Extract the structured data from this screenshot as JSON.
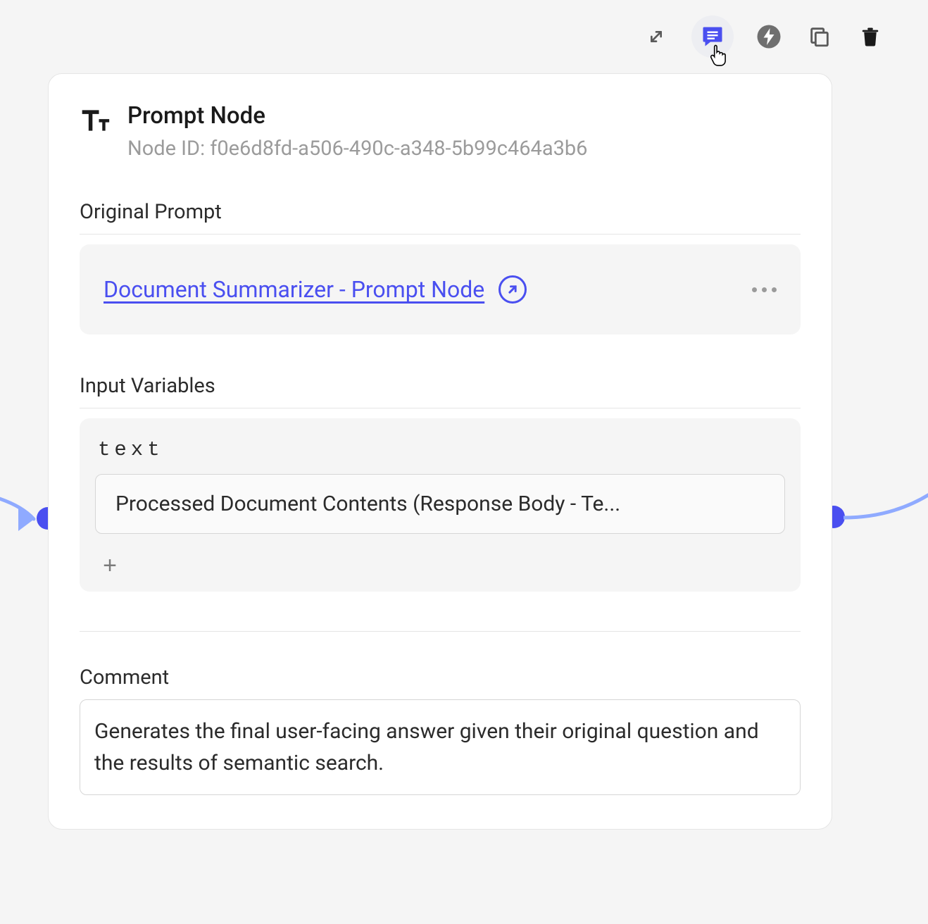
{
  "toolbar": {
    "expand": "expand",
    "comment": "comment",
    "flash": "flash",
    "copy": "copy",
    "delete": "delete"
  },
  "node": {
    "title": "Prompt Node",
    "id_label": "Node ID: ",
    "id_value": "f0e6d8fd-a506-490c-a348-5b99c464a3b6"
  },
  "sections": {
    "original_prompt": "Original Prompt",
    "input_variables": "Input Variables",
    "comment": "Comment"
  },
  "prompt": {
    "link_text": "Document Summarizer - Prompt Node"
  },
  "variables": [
    {
      "name": "text",
      "value": "Processed Document Contents (Response Body - Te..."
    }
  ],
  "comment": {
    "value": "Generates the final user-facing answer given their original question and the results of semantic search."
  }
}
